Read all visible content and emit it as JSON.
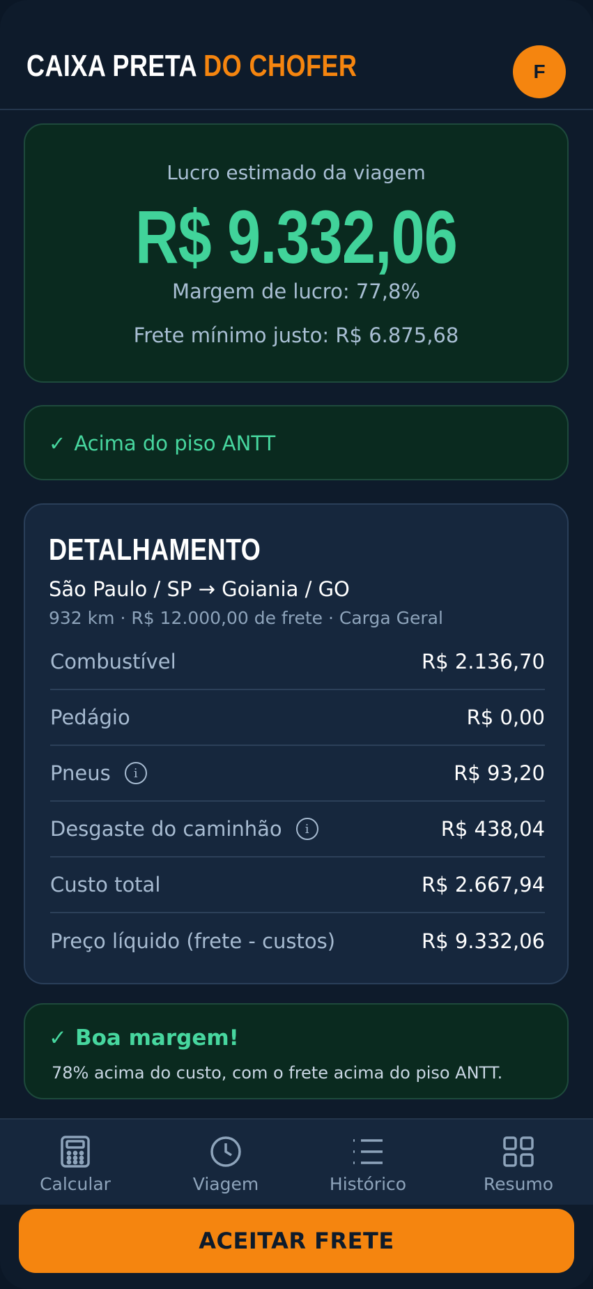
{
  "header": {
    "brand_part1": "CAIXA PRETA",
    "brand_part2": "DO CHOFER",
    "avatar_letter": "F"
  },
  "profit": {
    "label": "Lucro estimado da viagem",
    "amount": "R$ 9.332,06",
    "margin": "Margem de lucro: 77,8%",
    "min_freight": "Frete mínimo justo: R$ 6.875,68"
  },
  "antt": {
    "check": "✓",
    "text": "Acima do piso ANTT"
  },
  "details": {
    "title": "DETALHAMENTO",
    "route": "São Paulo / SP → Goiania / GO",
    "meta": "932 km · R$ 12.000,00 de frete · Carga Geral",
    "rows": [
      {
        "label": "Combustível",
        "value": "R$ 2.136,70"
      },
      {
        "label": "Pedágio",
        "value": "R$ 0,00"
      },
      {
        "label": "Pneus",
        "value": "R$ 93,20",
        "info": "i"
      },
      {
        "label": "Desgaste do caminhão",
        "value": "R$ 438,04",
        "info": "i"
      },
      {
        "label": "Custo total",
        "value": "R$ 2.667,94"
      },
      {
        "label": "Preço líquido (frete - custos)",
        "value": "R$ 9.332,06"
      }
    ]
  },
  "good": {
    "check": "✓",
    "title": "Boa margem!",
    "subtitle": "78% acima do custo, com o frete acima do piso ANTT."
  },
  "nav": [
    {
      "label": "Calcular",
      "icon": "calculator-icon"
    },
    {
      "label": "Viagem",
      "icon": "clock-icon"
    },
    {
      "label": "Histórico",
      "icon": "list-icon"
    },
    {
      "label": "Resumo",
      "icon": "grid-icon"
    }
  ],
  "cta": {
    "label": "ACEITAR FRETE"
  },
  "colors": {
    "accent": "#f5850f",
    "success": "#41d39a",
    "background": "#0e1b2b",
    "card": "#16273d"
  }
}
